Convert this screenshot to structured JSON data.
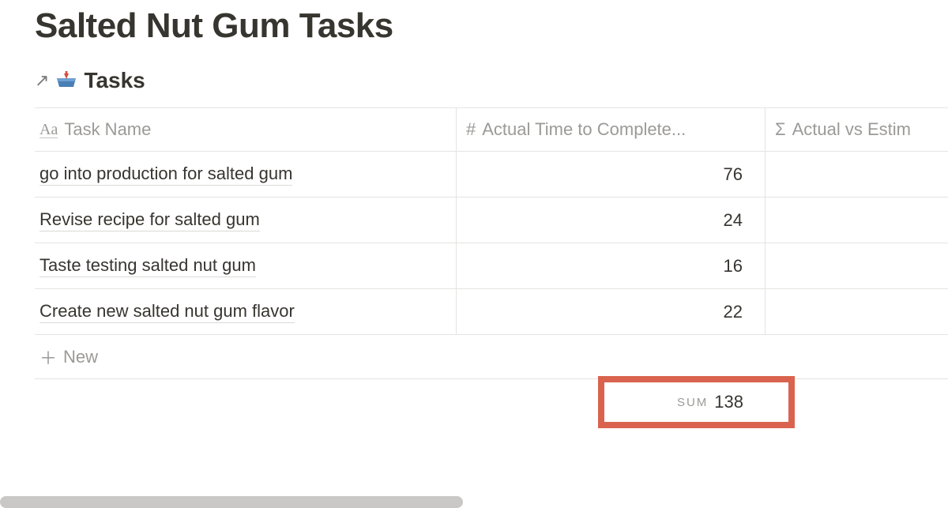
{
  "page": {
    "title": "Salted Nut Gum Tasks"
  },
  "database": {
    "title": "Tasks",
    "open_label": "↗",
    "icon": "inbox-icon"
  },
  "columns": {
    "task_name": {
      "label": "Task Name",
      "icon": "Aa"
    },
    "actual_time": {
      "label": "Actual Time to Complete...",
      "icon": "#"
    },
    "actual_vs_estim": {
      "label": "Actual vs Estim",
      "icon": "Σ"
    }
  },
  "rows": [
    {
      "task_name": "go into production for salted gum",
      "actual_time": "76",
      "actual_vs_estim": ""
    },
    {
      "task_name": "Revise recipe for salted gum",
      "actual_time": "24",
      "actual_vs_estim": ""
    },
    {
      "task_name": "Taste testing salted nut gum",
      "actual_time": "16",
      "actual_vs_estim": ""
    },
    {
      "task_name": "Create new salted nut gum flavor",
      "actual_time": "22",
      "actual_vs_estim": ""
    }
  ],
  "new_row_label": "New",
  "summary": {
    "actual_time": {
      "label": "SUM",
      "value": "138"
    }
  }
}
